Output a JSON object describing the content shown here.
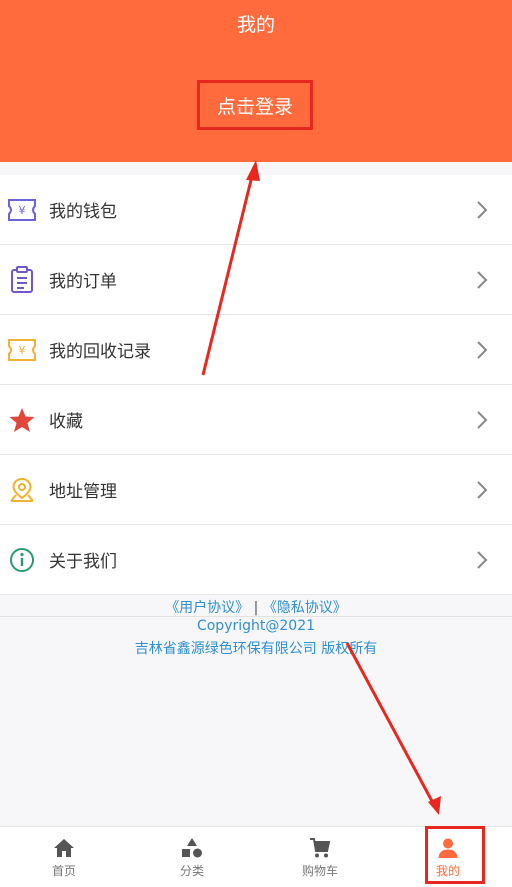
{
  "header": {
    "title": "我的",
    "login_label": "点击登录"
  },
  "menu": [
    {
      "label": "我的钱包",
      "icon": "wallet-icon"
    },
    {
      "label": "我的订单",
      "icon": "order-icon"
    },
    {
      "label": "我的回收记录",
      "icon": "recycle-record-icon"
    },
    {
      "label": "收藏",
      "icon": "star-icon"
    },
    {
      "label": "地址管理",
      "icon": "location-icon"
    },
    {
      "label": "关于我们",
      "icon": "info-icon"
    }
  ],
  "footer": {
    "user_agreement": "《用户协议》",
    "separator": "|",
    "privacy_policy": "《隐私协议》",
    "copyright": "Copyright@2021",
    "company": "吉林省鑫源绿色环保有限公司 版权所有"
  },
  "tabs": [
    {
      "label": "首页",
      "icon": "home-icon"
    },
    {
      "label": "分类",
      "icon": "category-icon"
    },
    {
      "label": "购物车",
      "icon": "cart-icon"
    },
    {
      "label": "我的",
      "icon": "user-icon"
    }
  ],
  "colors": {
    "accent": "#ff6b3d",
    "highlight": "#e8281e",
    "link": "#2f8fd0"
  }
}
